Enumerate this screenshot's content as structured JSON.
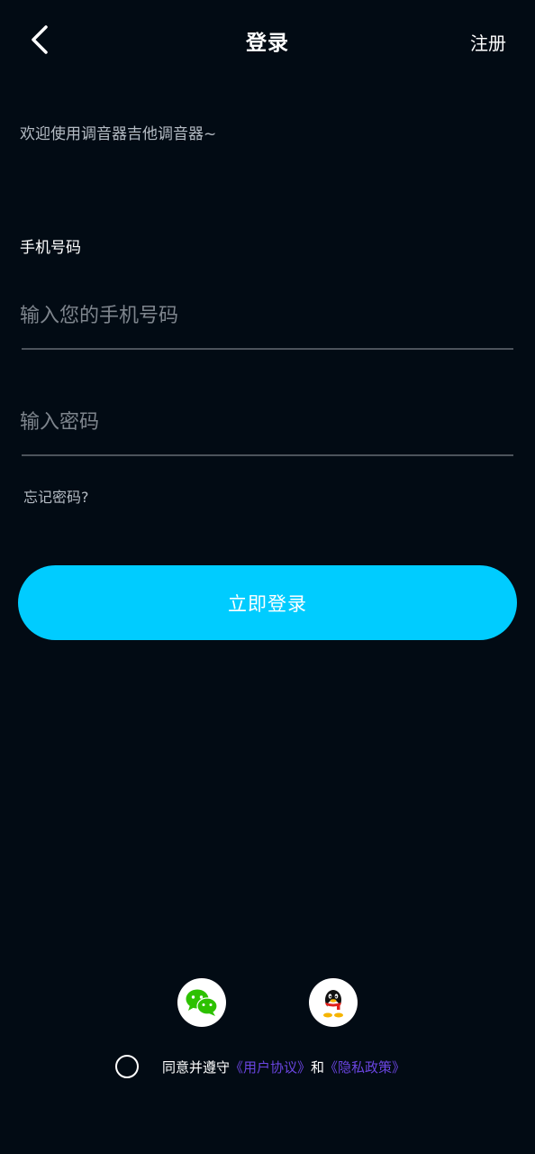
{
  "header": {
    "title": "登录",
    "register_label": "注册"
  },
  "welcome_text": "欢迎使用调音器吉他调音器~",
  "phone": {
    "label": "手机号码",
    "placeholder": "输入您的手机号码",
    "value": ""
  },
  "password": {
    "placeholder": "输入密码",
    "value": ""
  },
  "forgot_label": "忘记密码?",
  "login_label": "立即登录",
  "agreement": {
    "prefix": "同意并遵守",
    "user_agreement": "《用户协议》",
    "conjunction": "和",
    "privacy_policy": "《隐私政策》",
    "checked": false
  },
  "social": {
    "wechat_icon": "wechat-icon",
    "qq_icon": "qq-icon"
  },
  "colors": {
    "background": "#020b14",
    "accent": "#00ccff",
    "link": "#6a45e0",
    "divider": "#4c535b"
  }
}
